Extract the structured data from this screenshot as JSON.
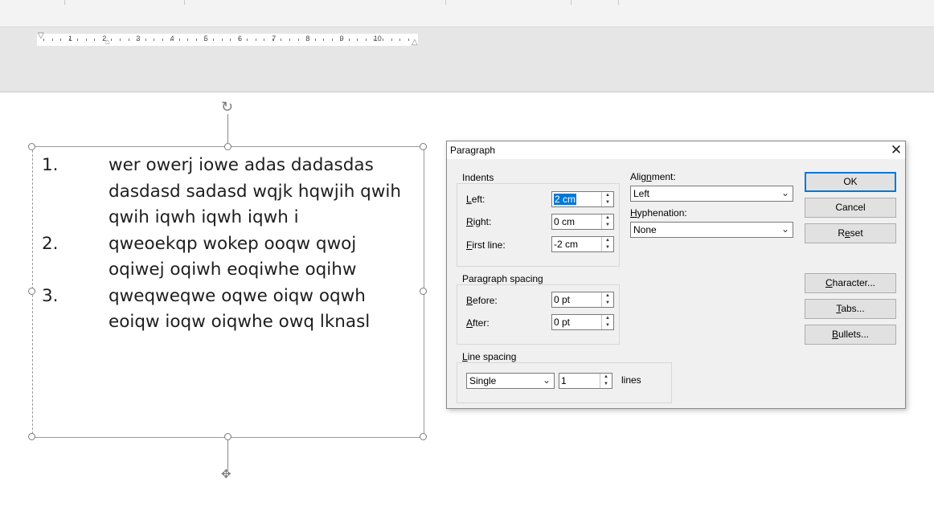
{
  "document": {
    "list_items": [
      {
        "number": "1.",
        "text": "wer owerj iowe adas dadasdas dasdasd sadasd wqjk hqwjih qwih qwih iqwh iqwh iqwh i"
      },
      {
        "number": "2.",
        "text": "qweoekqp wokep ooqw  qwoj oqiwej oqiwh eoqiwhe oqihw"
      },
      {
        "number": "3.",
        "text": "qweqweqwe oqwe oiqw oqwh eoiqw ioqw oiqwhe owq lknasl"
      }
    ]
  },
  "ruler": {
    "numbers": [
      "1",
      "2",
      "3",
      "4",
      "5",
      "6",
      "7",
      "8",
      "9",
      "10"
    ]
  },
  "dialog": {
    "title": "Paragraph",
    "indents": {
      "title": "Indents",
      "left_label": "Left:",
      "left_value": "2 cm",
      "right_label": "Right:",
      "right_value": "0 cm",
      "first_line_label": "First line:",
      "first_line_value": "-2 cm"
    },
    "alignment": {
      "label": "Alignment:",
      "value": "Left"
    },
    "hyphenation": {
      "label": "Hyphenation:",
      "value": "None"
    },
    "spacing": {
      "title": "Paragraph spacing",
      "before_label": "Before:",
      "before_value": "0 pt",
      "after_label": "After:",
      "after_value": "0 pt"
    },
    "line_spacing": {
      "title": "Line spacing",
      "mode": "Single",
      "value": "1",
      "unit": "lines"
    },
    "buttons": {
      "ok": "OK",
      "cancel": "Cancel",
      "reset": "Reset",
      "character": "Character...",
      "tabs": "Tabs...",
      "bullets": "Bullets..."
    }
  },
  "icons": {
    "close": "close-icon",
    "rotate": "rotate-icon",
    "move": "move-icon",
    "dropdown": "chevron-down-icon",
    "spin": "spin-arrows-icon"
  },
  "colors": {
    "selection": "#0078d7",
    "dialog_bg": "#f0f0f0",
    "ruler_area": "#e6e6e6"
  }
}
